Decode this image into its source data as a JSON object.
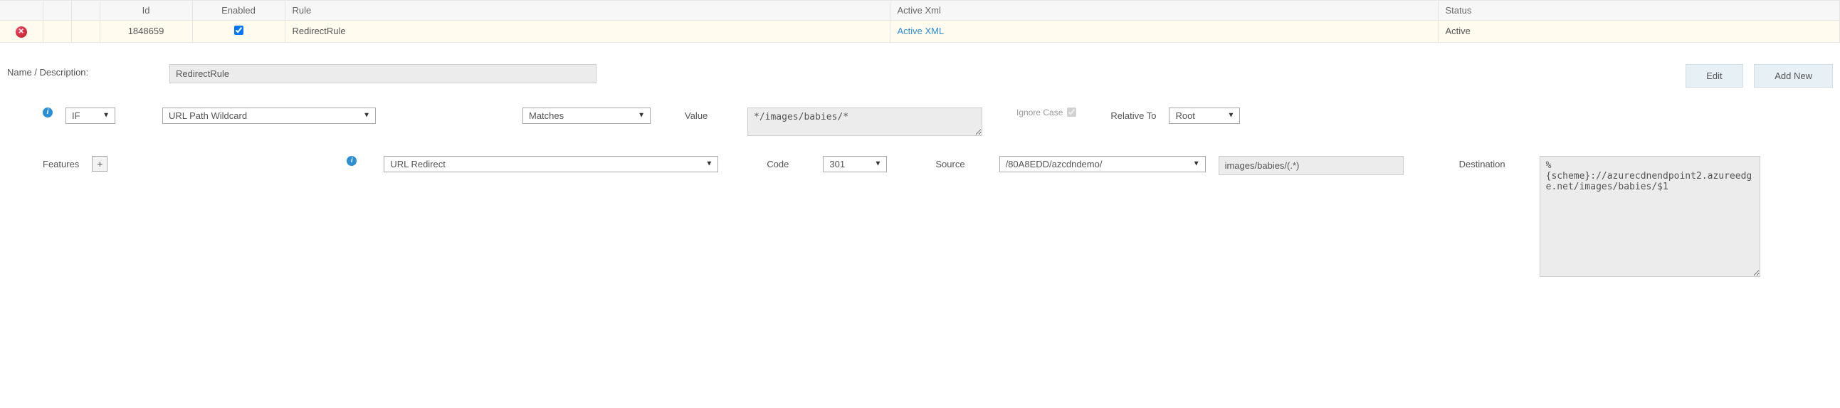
{
  "table": {
    "headers": {
      "id": "Id",
      "enabled": "Enabled",
      "rule": "Rule",
      "active_xml": "Active Xml",
      "status": "Status"
    },
    "row": {
      "id": "1848659",
      "rule": "RedirectRule",
      "active_xml_link": "Active XML",
      "status": "Active"
    }
  },
  "form": {
    "name_label": "Name / Description:",
    "name_value": "RedirectRule",
    "edit_btn": "Edit",
    "addnew_btn": "Add New",
    "if_label": "IF",
    "match_type": "URL Path Wildcard",
    "match_op": "Matches",
    "value_label": "Value",
    "value_text": "*/images/babies/*",
    "ignore_case_label": "Ignore Case",
    "relative_to_label": "Relative To",
    "relative_to_value": "Root",
    "features_label": "Features",
    "feature_type": "URL Redirect",
    "code_label": "Code",
    "code_value": "301",
    "source_label": "Source",
    "source_path": "/80A8EDD/azcdndemo/",
    "source_regex": "images/babies/(.*)",
    "destination_label": "Destination",
    "destination_value": "%{scheme}://azurecdnendpoint2.azureedge.net/images/babies/$1"
  }
}
